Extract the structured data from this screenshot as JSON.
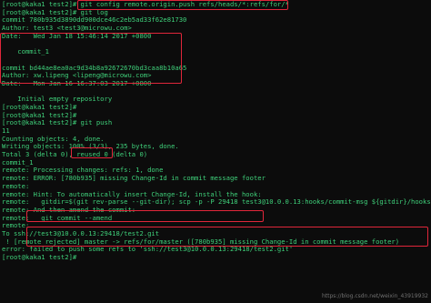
{
  "terminal": {
    "lines": [
      "[root@kaka1 test2]# git config remote.origin.push refs/heads/*:refs/for/*",
      "[root@kaka1 test2]# git log",
      "commit 780b935d3890dd900dce46c2eb5ad33f62e81730",
      "Author: test3 <test3@microwu.com>",
      "Date:   Wed Jan 18 15:46:14 2017 +0800",
      "",
      "    commit_1",
      "",
      "commit bd44ae8ea0ac9d34b8a92672670bd3caa8b10a65",
      "Author: xw.lipeng <lipeng@microwu.com>",
      "Date:   Mon Jan 16 16:37:03 2017 +0800",
      "",
      "    Initial empty repository",
      "[root@kaka1 test2]#",
      "[root@kaka1 test2]#",
      "[root@kaka1 test2]# git push",
      "11",
      "Counting objects: 4, done.",
      "Writing objects: 100% (3/3), 235 bytes, done.",
      "Total 3 (delta 0), reused 0 (delta 0)",
      "commit_1",
      "remote: Processing changes: refs: 1, done",
      "remote: ERROR: [780b935] missing Change-Id in commit message footer",
      "remote:",
      "remote: Hint: To automatically insert Change-Id, install the hook:",
      "remote:   gitdir=$(git rev-parse --git-dir); scp -p -P 29418 test3@10.0.0.13:hooks/commit-msg ${gitdir}/hooks/",
      "remote: And then amend the commit:",
      "remote:   git commit --amend",
      "remote:",
      "To ssh://test3@10.0.0.13:29418/test2.git",
      " ! [remote rejected] master -> refs/for/master ([780b935] missing Change-Id in commit message footer)",
      "error: failed to push some refs to 'ssh://test3@10.0.0.13:29418/test2.git'",
      "[root@kaka1 test2]#"
    ],
    "watermark": "https://blog.csdn.net/weixin_43919932"
  },
  "colors": {
    "text": "#3fd07a",
    "background": "#0c0c0c",
    "highlight": "#e0263a"
  }
}
